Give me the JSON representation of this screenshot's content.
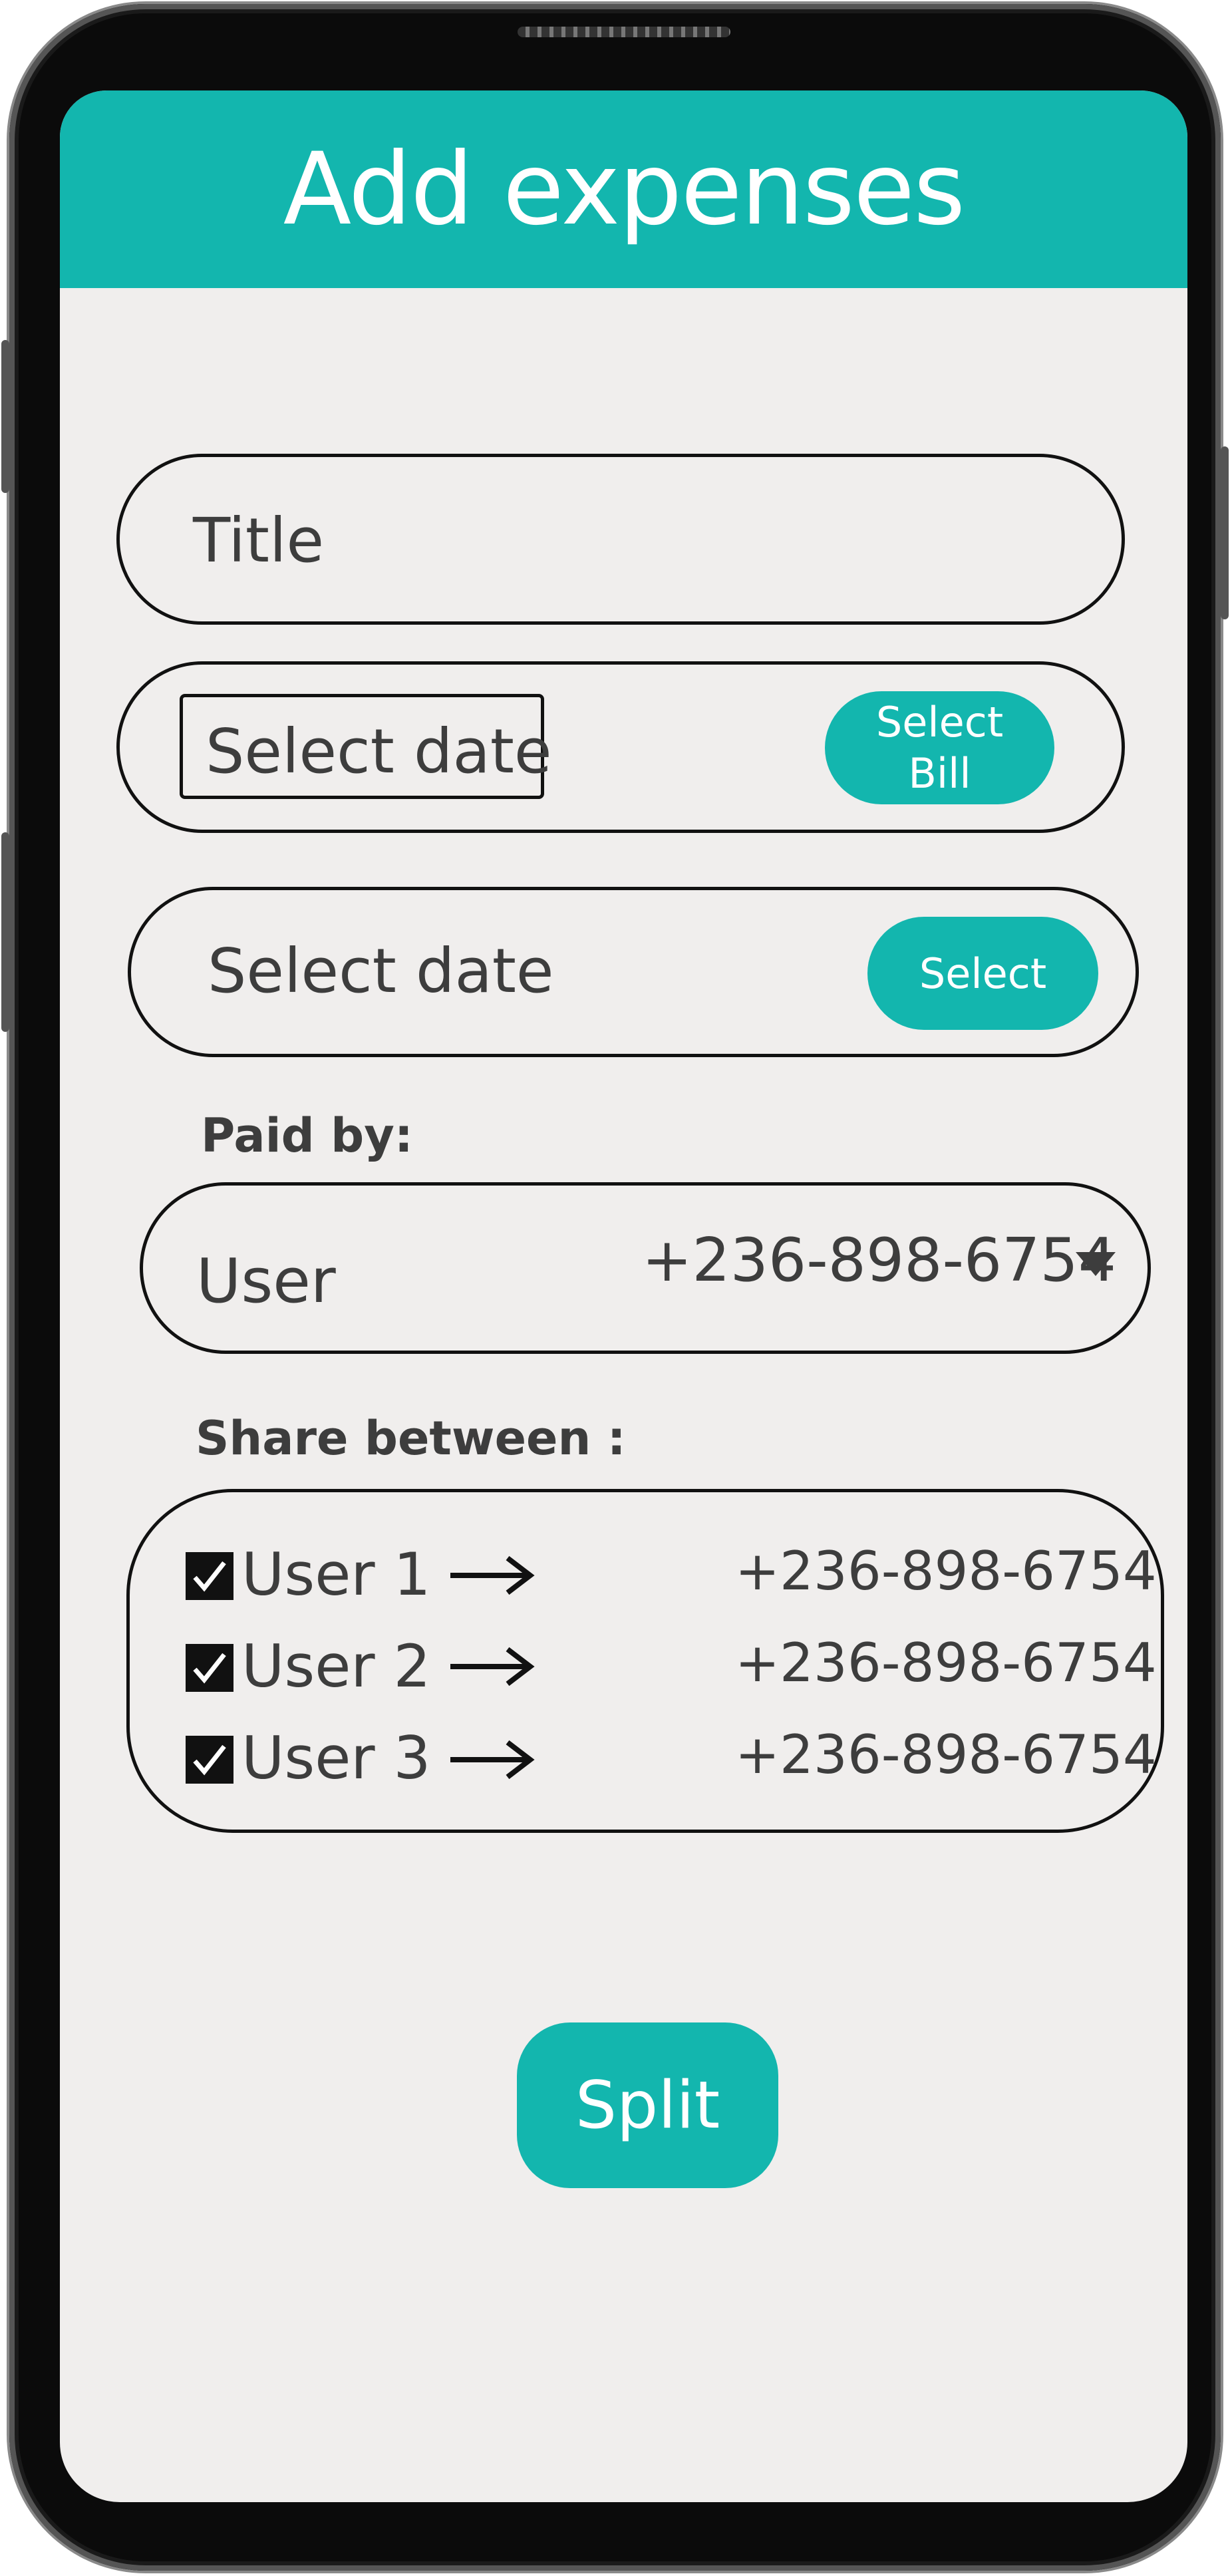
{
  "header": {
    "title": "Add expenses"
  },
  "form": {
    "title_field": {
      "placeholder": "Title"
    },
    "bill_date": {
      "placeholder": "Select date",
      "button_label_line1": "Select",
      "button_label_line2": "Bill"
    },
    "date": {
      "placeholder": "Select date",
      "button_label": "Select"
    },
    "paid_by": {
      "label": "Paid by:",
      "user": "User",
      "phone": "+236-898-6754",
      "dropdown_icon": "caret-down-icon"
    },
    "share_between": {
      "label": "Share between :",
      "users": [
        {
          "name": "User  1",
          "phone": "+236-898-6754",
          "checked": true
        },
        {
          "name": "User 2",
          "phone": "+236-898-6754",
          "checked": true
        },
        {
          "name": "User 3",
          "phone": "+236-898-6754",
          "checked": true
        }
      ]
    },
    "split_button": "Split"
  },
  "colors": {
    "accent": "#13b6ae",
    "background": "#f0eeed",
    "text": "#3d3d3d"
  }
}
